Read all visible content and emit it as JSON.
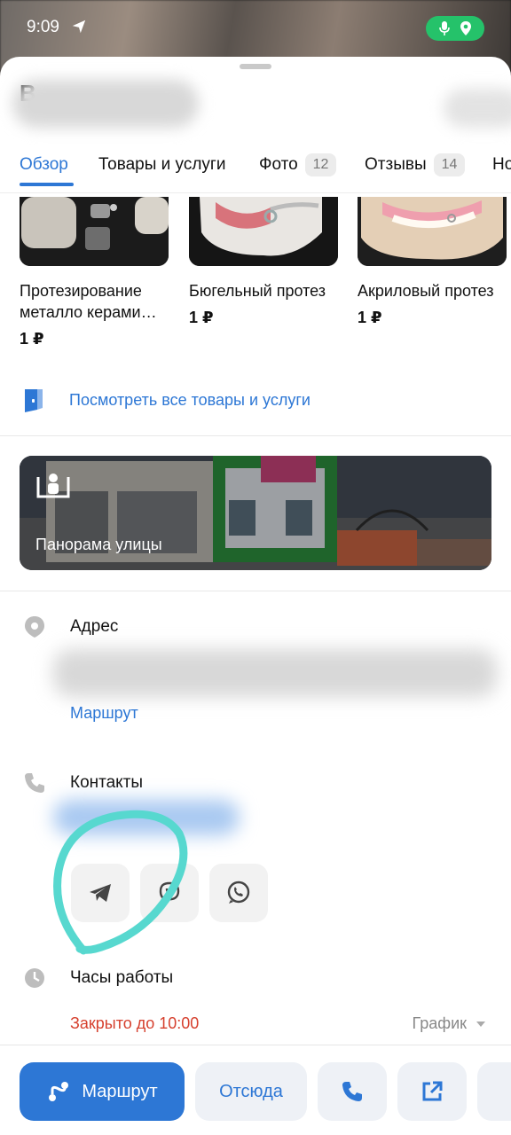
{
  "status_bar": {
    "time": "9:09"
  },
  "tabs": [
    {
      "label": "Обзор",
      "active": true
    },
    {
      "label": "Товары и услуги"
    },
    {
      "label": "Фото",
      "badge": "12"
    },
    {
      "label": "Отзывы",
      "badge": "14"
    },
    {
      "label": "Но"
    }
  ],
  "title_fragment": "В",
  "products": [
    {
      "name": "Протезирование металло керами…",
      "price": "1 ₽"
    },
    {
      "name": "Бюгельный протез",
      "price": "1 ₽"
    },
    {
      "name": "Акриловый протез",
      "price": "1 ₽"
    }
  ],
  "see_all_label": "Посмотреть все товары и услуги",
  "panorama_label": "Панорама улицы",
  "address": {
    "title": "Адрес",
    "route_link": "Маршрут"
  },
  "contacts": {
    "title": "Контакты"
  },
  "hours": {
    "title": "Часы работы",
    "status": "Закрыто до 10:00",
    "schedule_label": "График"
  },
  "bottom_bar": {
    "route_label": "Маршрут",
    "from_here_label": "Отсюда"
  },
  "colors": {
    "accent": "#2d77d5",
    "closed": "#d6402e",
    "status_pill": "#25c26a",
    "highlight": "#57d8cf"
  }
}
